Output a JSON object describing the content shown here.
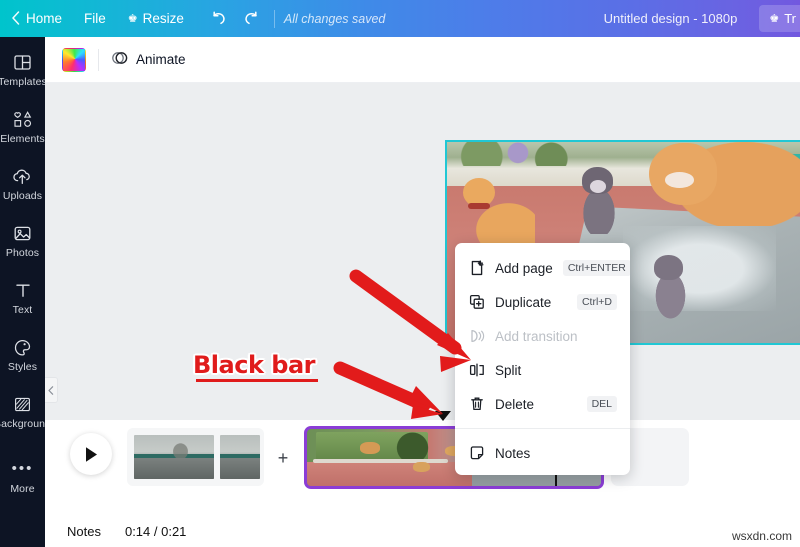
{
  "topbar": {
    "back_icon": "chevron-left-icon",
    "home": "Home",
    "file": "File",
    "resize": "Resize",
    "resize_icon": "crown-icon",
    "undo_icon": "undo-icon",
    "redo_icon": "redo-icon",
    "saved_status": "All changes saved",
    "design_title": "Untitled design - 1080p",
    "try_label": "Tr",
    "try_icon": "crown-icon",
    "gradient_start": "#00c4cc",
    "gradient_end": "#7258df"
  },
  "sidebar": {
    "items": [
      {
        "label": "Templates",
        "icon": "templates-icon"
      },
      {
        "label": "Elements",
        "icon": "elements-icon"
      },
      {
        "label": "Uploads",
        "icon": "upload-cloud-icon"
      },
      {
        "label": "Photos",
        "icon": "photo-icon"
      },
      {
        "label": "Text",
        "icon": "text-icon"
      },
      {
        "label": "Styles",
        "icon": "palette-icon"
      },
      {
        "label": "Background",
        "icon": "background-icon"
      },
      {
        "label": "More",
        "icon": "more-dots-icon"
      }
    ]
  },
  "toolbar": {
    "color_swatch": "rainbow-gradient-swatch",
    "animate_label": "Animate",
    "animate_icon": "animate-circles-icon"
  },
  "canvas": {
    "collapse_icon": "chevron-left-icon",
    "selection_color": "#21c7d4",
    "background_color": "#eceef0"
  },
  "context_menu": {
    "items": [
      {
        "label": "Add page",
        "shortcut": "Ctrl+ENTER",
        "icon": "add-page-icon",
        "disabled": false
      },
      {
        "label": "Duplicate",
        "shortcut": "Ctrl+D",
        "icon": "duplicate-icon",
        "disabled": false
      },
      {
        "label": "Add transition",
        "shortcut": "",
        "icon": "transition-icon",
        "disabled": true
      },
      {
        "label": "Split",
        "shortcut": "",
        "icon": "split-icon",
        "disabled": false
      },
      {
        "label": "Delete",
        "shortcut": "DEL",
        "icon": "trash-icon",
        "disabled": false
      }
    ],
    "footer_item": {
      "label": "Notes",
      "shortcut": "",
      "icon": "note-icon",
      "disabled": false
    }
  },
  "timeline": {
    "play_icon": "play-icon",
    "add_clip_label": "+",
    "selection_color": "#8b3dd6",
    "notes_label": "Notes",
    "time_display": "0:14 / 0:21"
  },
  "annotations": {
    "label": "Black bar",
    "color": "#e01b1b",
    "arrow_1": "red-arrow-to-split",
    "arrow_2": "red-arrow-to-playhead"
  },
  "watermark": {
    "text": "wsxdn.com"
  }
}
